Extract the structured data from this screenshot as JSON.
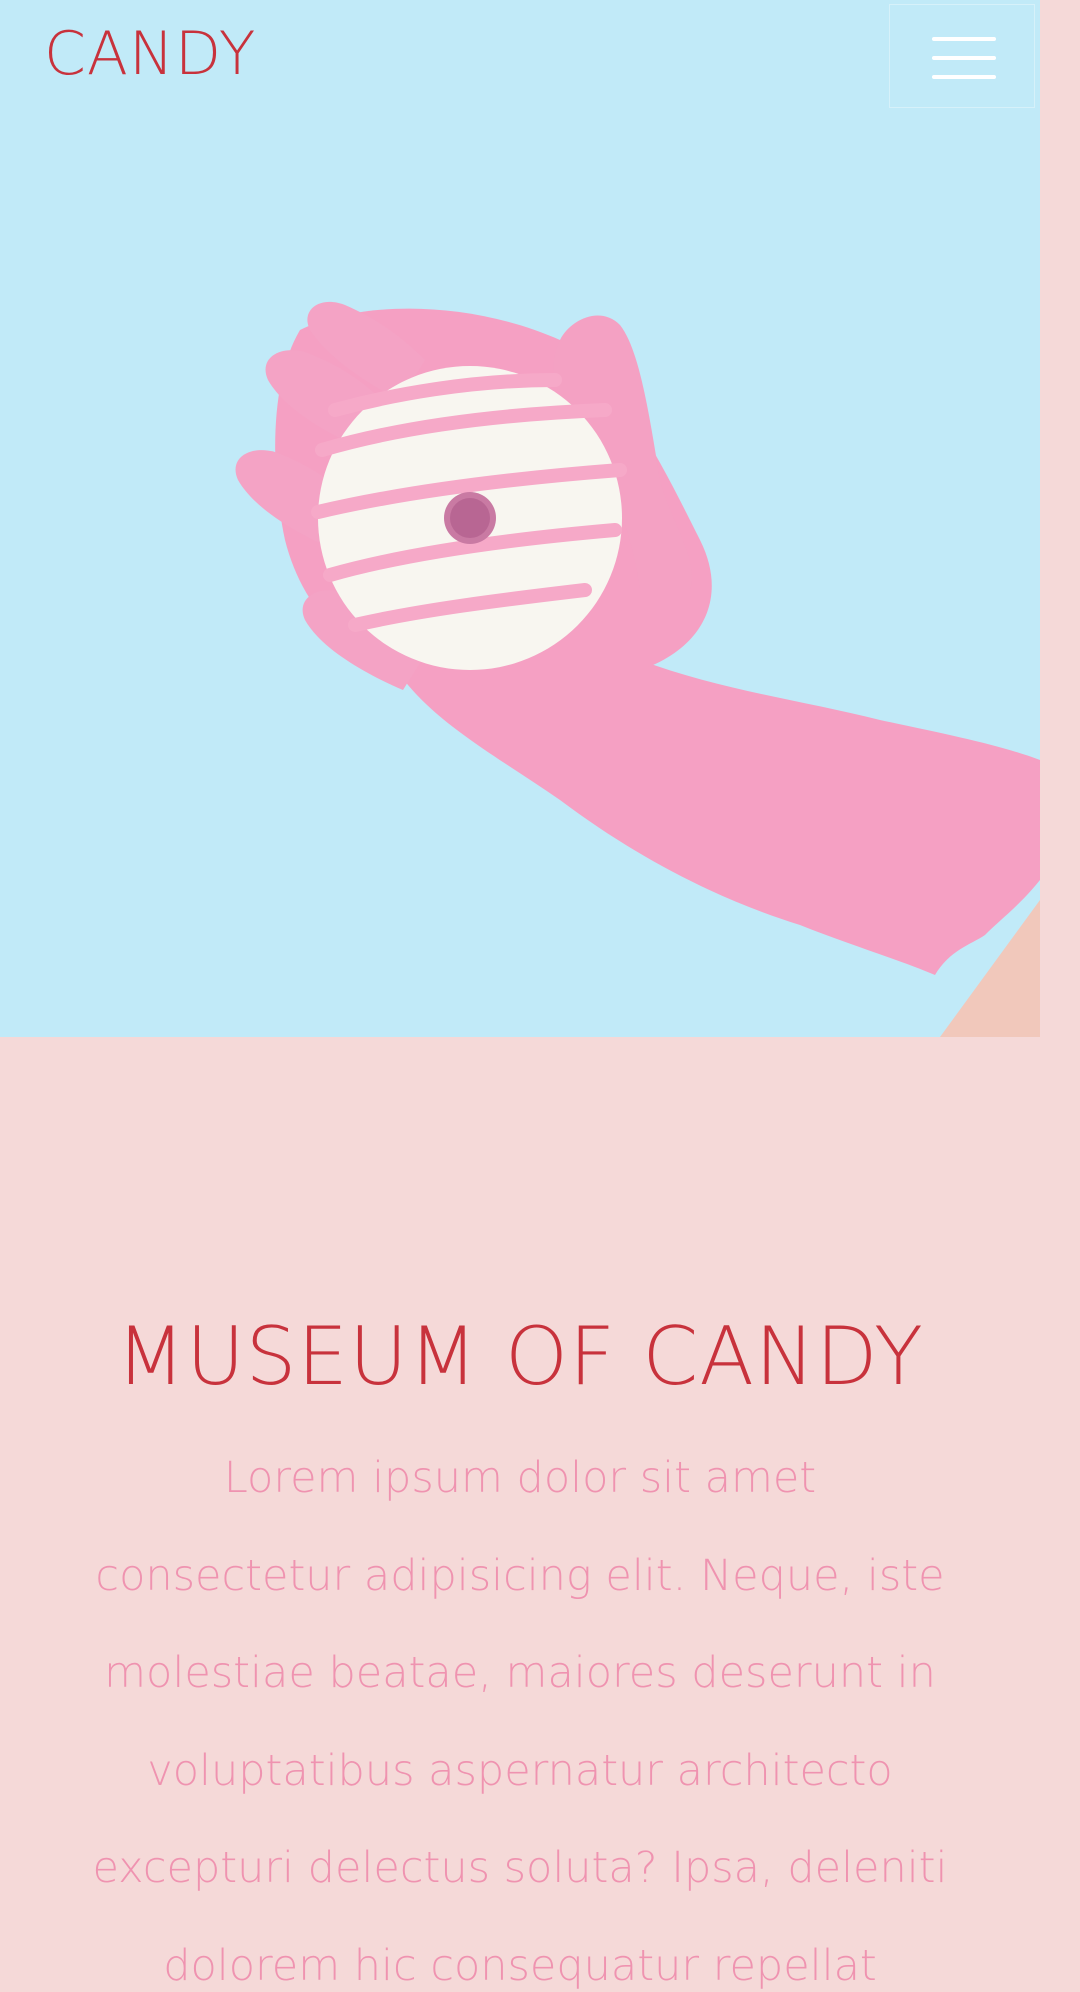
{
  "header": {
    "brand": "CANDY",
    "menu_icon": "hamburger-menu-icon"
  },
  "hero": {
    "image_subject": "pink-glove-holding-donut-illustration",
    "colors": {
      "background": "#c1eaf8",
      "glove": "#f6a2c4",
      "donut": "#f8f6f0",
      "drizzle": "#f6a9c8"
    }
  },
  "main": {
    "title": "MUSEUM OF CANDY",
    "body": "Lorem ipsum dolor sit amet consectetur adipisicing elit. Neque, iste molestiae beatae, maiores deserunt in voluptatibus aspernatur architecto excepturi delectus soluta? Ipsa, deleniti dolorem hic consequatur repellat"
  },
  "colors": {
    "page_background": "#f5d9d8",
    "accent_red": "#c8323c",
    "text_pink": "#ef93b0"
  }
}
